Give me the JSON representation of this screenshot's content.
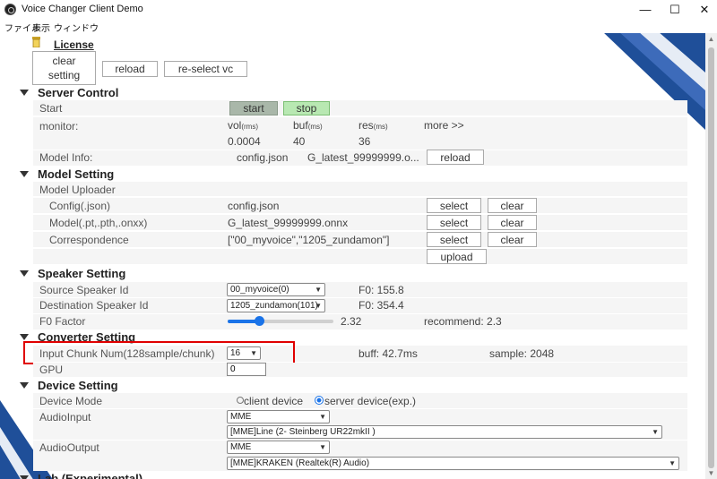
{
  "window": {
    "title": "Voice Changer Client Demo",
    "minimize": "—",
    "maximize": "☐",
    "close": "✕"
  },
  "menu": [
    "ファイル",
    "表示",
    "ウィンドウ"
  ],
  "header": {
    "license": "License",
    "clear_setting_l1": "clear",
    "clear_setting_l2": "setting",
    "reload": "reload",
    "reselect_vc": "re-select vc"
  },
  "server_control": {
    "title": "Server Control",
    "start_label": "Start",
    "start_btn": "start",
    "stop_btn": "stop",
    "monitor_label": "monitor:",
    "vol": "vol",
    "vol_unit": "(rms)",
    "buf": "buf",
    "buf_unit": "(ms)",
    "res": "res",
    "res_unit": "(ms)",
    "more": "more >>",
    "vol_value": "0.0004",
    "buf_value": "40",
    "res_value": "36",
    "model_info_label": "Model Info:",
    "model_info_config": "config.json",
    "model_info_model": "G_latest_99999999.o...",
    "reload": "reload"
  },
  "model_setting": {
    "title": "Model Setting",
    "uploader": "Model Uploader",
    "config_label": "Config(.json)",
    "config_value": "config.json",
    "model_label": "Model(.pt,.pth,.onxx)",
    "model_value": "G_latest_99999999.onnx",
    "corr_label": "Correspondence",
    "corr_value": "[\"00_myvoice\",\"1205_zundamon\"]",
    "select": "select",
    "clear": "clear",
    "upload": "upload"
  },
  "speaker_setting": {
    "title": "Speaker Setting",
    "source_label": "Source Speaker Id",
    "source_value": "00_myvoice(0)",
    "source_f0": "F0: 155.8",
    "dest_label": "Destination Speaker Id",
    "dest_value": "1205_zundamon(101)",
    "dest_f0": "F0: 354.4",
    "f0_label": "F0 Factor",
    "f0_value": "2.32",
    "f0_slider": 0.3,
    "recommend": "recommend: 2.3"
  },
  "converter_setting": {
    "title": "Converter Setting",
    "chunk_label": "Input Chunk Num(128sample/chunk)",
    "chunk_value": "16",
    "buff": "buff: 42.7ms",
    "sample": "sample: 2048",
    "gpu_label": "GPU",
    "gpu_value": "0"
  },
  "device_setting": {
    "title": "Device Setting",
    "mode_label": "Device Mode",
    "client_device": "client device",
    "server_device": "server device(exp.)",
    "input_label": "AudioInput",
    "input_api": "MME",
    "input_device": "[MME]Line (2- Steinberg UR22mkII )",
    "output_label": "AudioOutput",
    "output_api": "MME",
    "output_device": "[MME]KRAKEN (Realtek(R) Audio)"
  },
  "lab_partial": "Lab (Experimental)",
  "colors": {
    "start_btn": "#a9b7a9",
    "stop_btn": "#b8e8b2",
    "highlight": "#e00000",
    "deco_blue": "#1f4f99",
    "row_bg": "#f5f5f5"
  }
}
